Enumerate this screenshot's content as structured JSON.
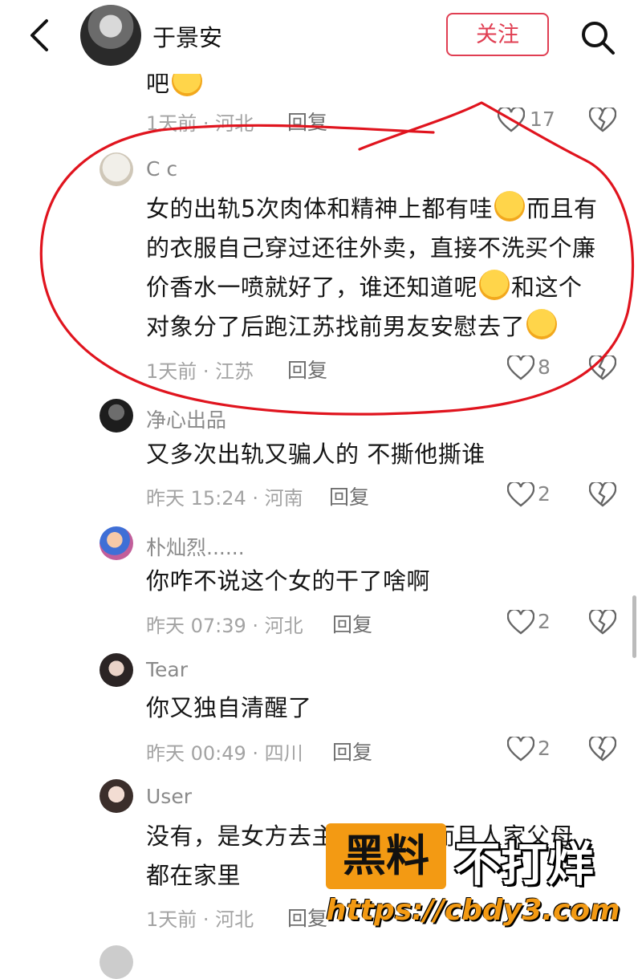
{
  "header": {
    "name": "于景安",
    "follow_label": "关注"
  },
  "partial_comment": {
    "text_tail": "吧",
    "meta": "1天前 · 河北",
    "reply_label": "回复",
    "likes": "17"
  },
  "comments": [
    {
      "user": "C c",
      "lines": [
        "女的出轨5次肉体和精神上都有哇",
        "而且有",
        "的衣服自己穿过还往外卖，直接不洗买个廉",
        "价香水一喷就好了，谁还知道呢",
        "和这个",
        "对象分了后跑江苏找前男友安慰去了"
      ],
      "meta": "1天前 · 江苏",
      "reply_label": "回复",
      "likes": "8"
    },
    {
      "user": "净心出品",
      "lines": [
        "又多次出轨又骗人的 不撕他撕谁"
      ],
      "meta": "昨天 15:24 · 河南",
      "reply_label": "回复",
      "likes": "2"
    },
    {
      "user": "朴灿烈......",
      "lines": [
        "你咋不说这个女的干了啥啊"
      ],
      "meta": "昨天 07:39 · 河北",
      "reply_label": "回复",
      "likes": "2"
    },
    {
      "user": "Tear",
      "lines": [
        "你又独自清醒了"
      ],
      "meta": "昨天 00:49 · 四川",
      "reply_label": "回复",
      "likes": "2"
    },
    {
      "user": "User",
      "lines": [
        "没有，是女方去主",
        "而且人家父母",
        "都在家里"
      ],
      "meta": "1天前 · 河北",
      "reply_label": "回复"
    }
  ],
  "watermark": {
    "box_text": "黑料",
    "text": "不打烊",
    "url": "https://cbdy3.com"
  },
  "colors": {
    "accent": "#e03e52",
    "annotation": "#e0141e",
    "watermark_orange": "#f39a13"
  },
  "icons": [
    "back-arrow-icon",
    "search-icon",
    "heart-icon",
    "broken-heart-icon"
  ]
}
